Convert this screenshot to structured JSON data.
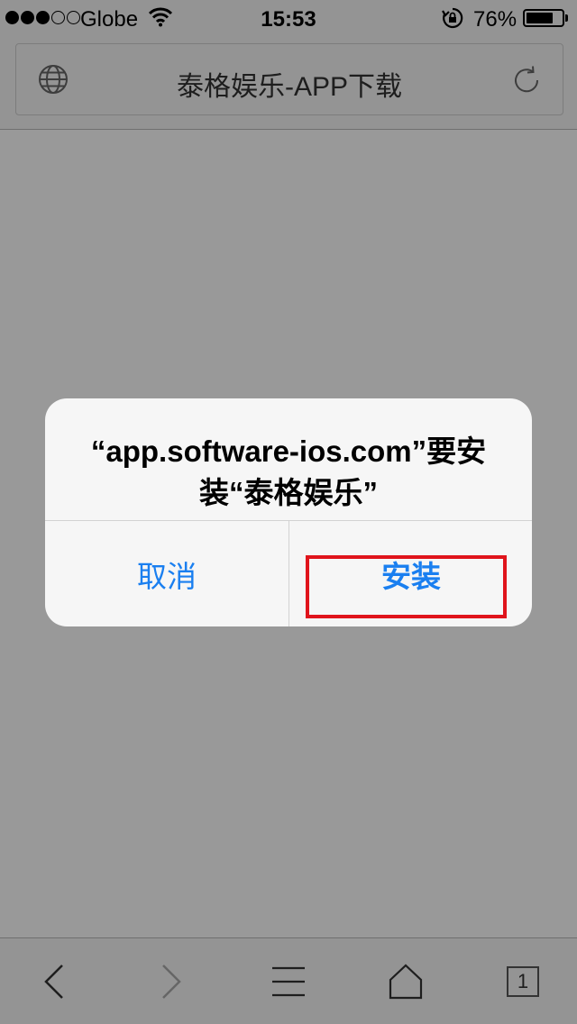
{
  "status_bar": {
    "carrier": "Globe",
    "time": "15:53",
    "battery_percent": "76%",
    "battery_level": 0.76,
    "signal_bars_filled": 3,
    "signal_bars_total": 5
  },
  "browser": {
    "page_title": "泰格娱乐-APP下载",
    "tab_count": "1"
  },
  "alert": {
    "message_line1": "“app.software-ios.com”要安",
    "message_line2": "装“泰格娱乐”",
    "cancel_label": "取消",
    "install_label": "安装"
  },
  "colors": {
    "accent": "#1a7ff0",
    "highlight": "#e0141c"
  },
  "icons": {
    "signal": "signal-dots-icon",
    "wifi": "wifi-icon",
    "orientation_lock": "orientation-lock-icon",
    "battery": "battery-icon",
    "globe": "globe-icon",
    "refresh": "refresh-icon",
    "back": "chevron-left-icon",
    "forward": "chevron-right-icon",
    "menu": "menu-icon",
    "home": "home-icon",
    "tabs": "tabs-icon"
  }
}
